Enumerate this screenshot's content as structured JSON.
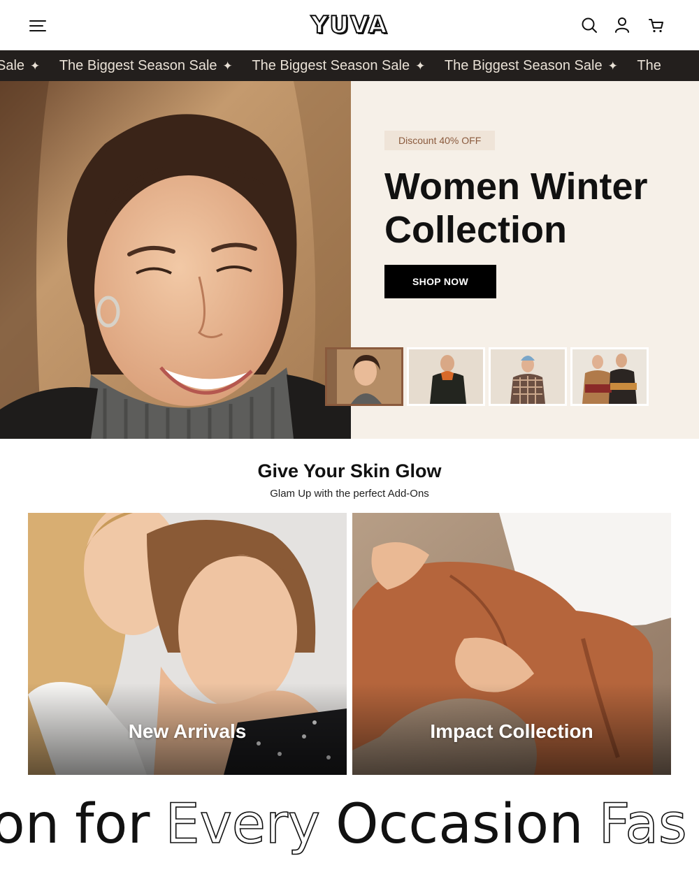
{
  "header": {
    "logo_text": "YUVA",
    "icons": [
      "menu-icon",
      "search-icon",
      "user-icon",
      "cart-icon"
    ]
  },
  "announcement": {
    "items": [
      "Sale",
      "The Biggest Season Sale",
      "The Biggest Season Sale",
      "The Biggest Season Sale",
      "The"
    ],
    "separator": "✦"
  },
  "hero": {
    "badge": "Discount 40% OFF",
    "title": "Women Winter Collection",
    "button_label": "SHOP NOW",
    "thumbnail_count": 4,
    "active_thumbnail": 1
  },
  "section": {
    "title": "Give Your Skin Glow",
    "subtitle": "Glam Up with the perfect Add-Ons"
  },
  "collections": [
    {
      "label": "New Arrivals"
    },
    {
      "label": "Impact Collection"
    }
  ],
  "tagline": {
    "words": [
      "on",
      "for",
      "Every",
      "Occasion",
      "Fas"
    ],
    "styles": [
      "outline",
      "solid",
      "outline",
      "solid",
      "outline"
    ]
  },
  "colors": {
    "announcement_bg": "#231f1d",
    "hero_bg": "#f6f0e8",
    "badge_bg": "#efe4d8",
    "accent_brown": "#8a5a3d",
    "button_bg": "#000000"
  }
}
